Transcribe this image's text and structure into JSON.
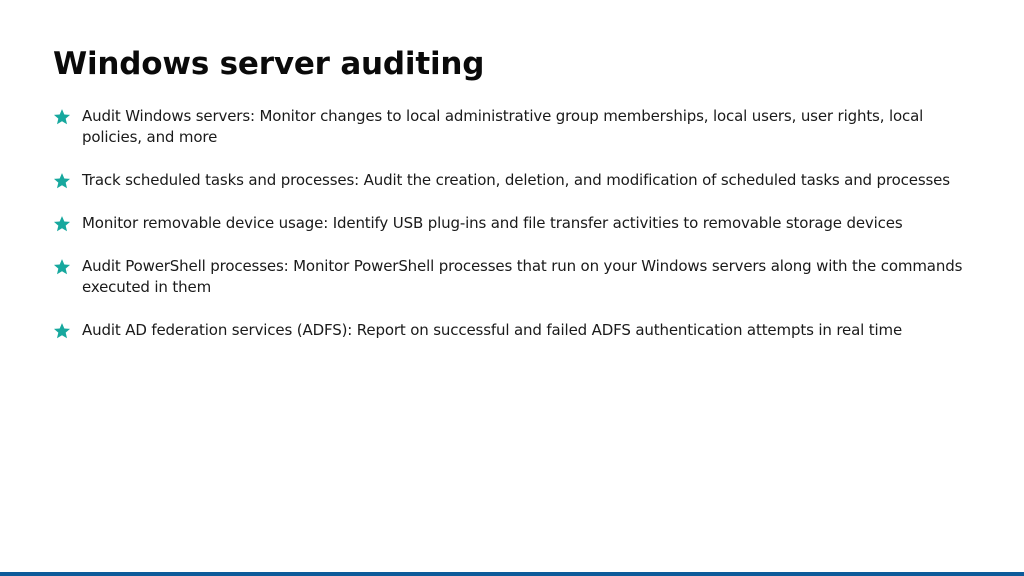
{
  "slide": {
    "title": "Windows server auditing",
    "bullet_icon": "star-icon",
    "accent_color": "#17a89e",
    "bottom_bar_color": "#0d5b9a",
    "bullets": [
      {
        "text": "Audit Windows servers: Monitor changes to local administrative group memberships, local users, user rights, local policies, and more"
      },
      {
        "text": "Track scheduled tasks and processes: Audit the creation, deletion, and modification of scheduled tasks and processes"
      },
      {
        "text": "Monitor removable device usage: Identify USB plug-ins and file transfer activities to removable storage devices"
      },
      {
        "text": "Audit PowerShell processes: Monitor PowerShell processes that run on your Windows servers along with the commands executed in them"
      },
      {
        "text": "Audit AD federation services (ADFS): Report on successful and failed ADFS authentication attempts in real time"
      }
    ]
  }
}
